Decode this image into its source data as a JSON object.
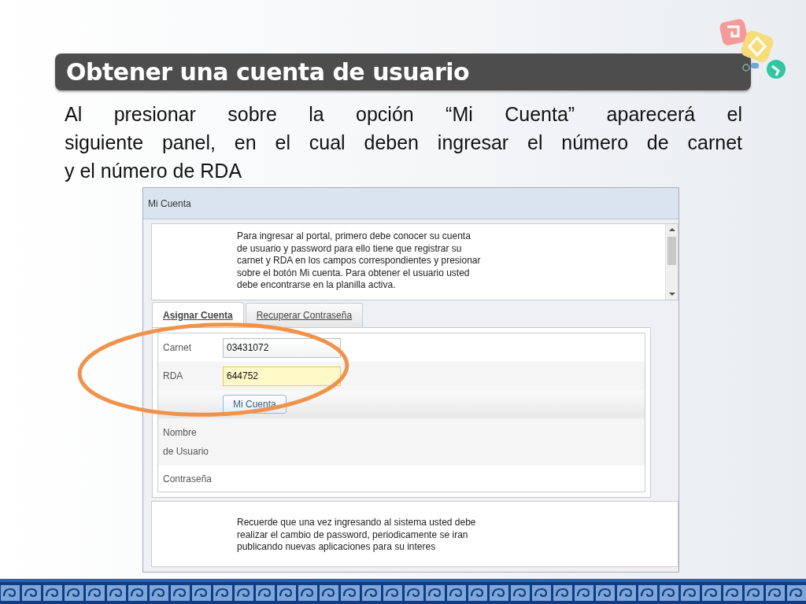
{
  "slide": {
    "title": "Obtener una cuenta de usuario",
    "paragraph_lines": [
      "Al presionar sobre la opción “Mi Cuenta” aparecerá el",
      "siguiente panel, en el cual deben ingresar el número de carnet",
      "y el número de RDA"
    ]
  },
  "screenshot": {
    "panel_title": "Mi Cuenta",
    "intro_lines": [
      "Para ingresar al portal, primero debe conocer su cuenta",
      "de usuario y password para ello tiene que registrar su",
      "carnet y RDA en los campos correspondientes y presionar",
      "sobre el botón Mi cuenta. Para obtener el usuario usted",
      "debe encontrarse en la planilla activa."
    ],
    "tabs": [
      {
        "label": "Asignar Cuenta",
        "selected": true
      },
      {
        "label": "Recuperar Contraseña",
        "selected": false
      }
    ],
    "form_rows": [
      {
        "kind": "input",
        "label": "Carnet",
        "value": "03431072",
        "focused": false
      },
      {
        "kind": "input",
        "label": "RDA",
        "value": "644752",
        "focused": true
      },
      {
        "kind": "button",
        "button": "Mi Cuenta"
      },
      {
        "kind": "text",
        "label_lines": [
          "Nombre",
          "de Usuario"
        ]
      },
      {
        "kind": "text",
        "label_lines": [
          "Contraseña"
        ]
      }
    ],
    "notice_lines": [
      "Recuerde que una vez ingresando al sistema usted debe",
      "realizar el cambio de password, periodicamente se iran",
      "publicando nuevas aplicaciones para su interes"
    ]
  }
}
